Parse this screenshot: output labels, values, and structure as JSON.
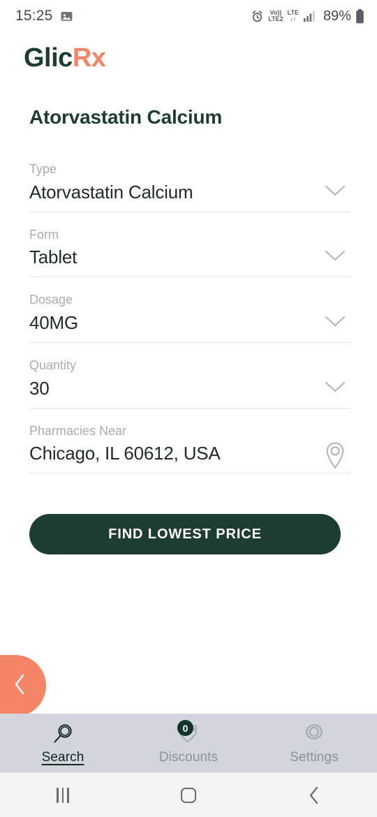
{
  "status_bar": {
    "time": "15:25",
    "left_icons": [
      "image-icon"
    ],
    "alarm_icon": "alarm-icon",
    "volte_line1": "Vo))",
    "volte_line2": "LTE2",
    "lte_label": "LTE",
    "data_arrows": "↓↑",
    "signal_icon": "signal-bars-icon",
    "battery_percent": "89%",
    "battery_icon": "battery-icon"
  },
  "brand": {
    "name_part1": "Glic",
    "name_part2": "Rx",
    "color_dark": "#1d3d33",
    "color_accent": "#f58567"
  },
  "page": {
    "title": "Atorvastatin Calcium"
  },
  "form": {
    "fields": [
      {
        "label": "Type",
        "value": "Atorvastatin Calcium",
        "icon": "chevron-down-icon",
        "name": "type"
      },
      {
        "label": "Form",
        "value": "Tablet",
        "icon": "chevron-down-icon",
        "name": "form"
      },
      {
        "label": "Dosage",
        "value": "40MG",
        "icon": "chevron-down-icon",
        "name": "dosage"
      },
      {
        "label": "Quantity",
        "value": "30",
        "icon": "chevron-down-icon",
        "name": "quantity"
      },
      {
        "label": "Pharmacies Near",
        "value": "Chicago, IL 60612, USA",
        "icon": "location-pin-icon",
        "name": "pharmacies-near"
      }
    ],
    "submit_label": "FIND LOWEST PRICE"
  },
  "floating_back": {
    "icon": "chevron-left-icon"
  },
  "tabbar": {
    "tabs": [
      {
        "label": "Search",
        "icon": "search-icon",
        "active": true
      },
      {
        "label": "Discounts",
        "icon": "tag-icon",
        "badge": "0",
        "active": false
      },
      {
        "label": "Settings",
        "icon": "gear-icon",
        "active": false
      }
    ]
  },
  "android_nav": {
    "recents": "recents-icon",
    "home": "home-icon",
    "back": "back-icon"
  }
}
